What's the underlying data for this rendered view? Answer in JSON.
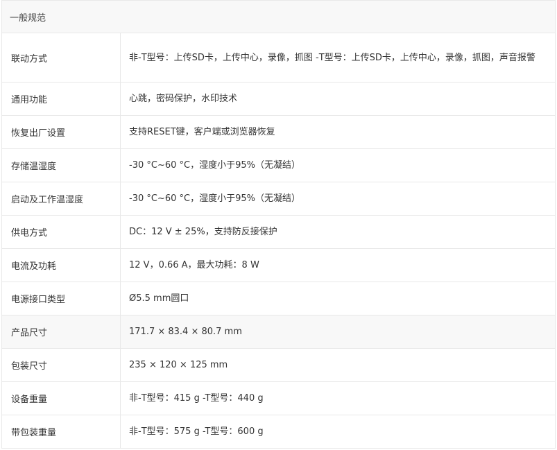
{
  "section_title": "一般规范",
  "rows": [
    {
      "label": "联动方式",
      "value": "非-T型号：上传SD卡，上传中心，录像，抓图 -T型号：上传SD卡，上传中心，录像，抓图，声音报警"
    },
    {
      "label": "通用功能",
      "value": "心跳，密码保护，水印技术"
    },
    {
      "label": "恢复出厂设置",
      "value": "支持RESET键，客户端或浏览器恢复"
    },
    {
      "label": "存储温湿度",
      "value": "-30 °C~60 °C，湿度小于95%（无凝结）"
    },
    {
      "label": "启动及工作温湿度",
      "value": "-30 °C~60 °C，湿度小于95%（无凝结）"
    },
    {
      "label": "供电方式",
      "value": "DC：12 V ± 25%，支持防反接保护"
    },
    {
      "label": "电流及功耗",
      "value": "12 V，0.66 A，最大功耗：8 W"
    },
    {
      "label": "电源接口类型",
      "value": "Ø5.5 mm圆口"
    },
    {
      "label": "产品尺寸",
      "value": "171.7 × 83.4 × 80.7 mm"
    },
    {
      "label": "包装尺寸",
      "value": "235 × 120 × 125 mm"
    },
    {
      "label": "设备重量",
      "value": "非-T型号：415 g -T型号：440 g"
    },
    {
      "label": "带包装重量",
      "value": "非-T型号：575 g -T型号：600 g"
    }
  ]
}
